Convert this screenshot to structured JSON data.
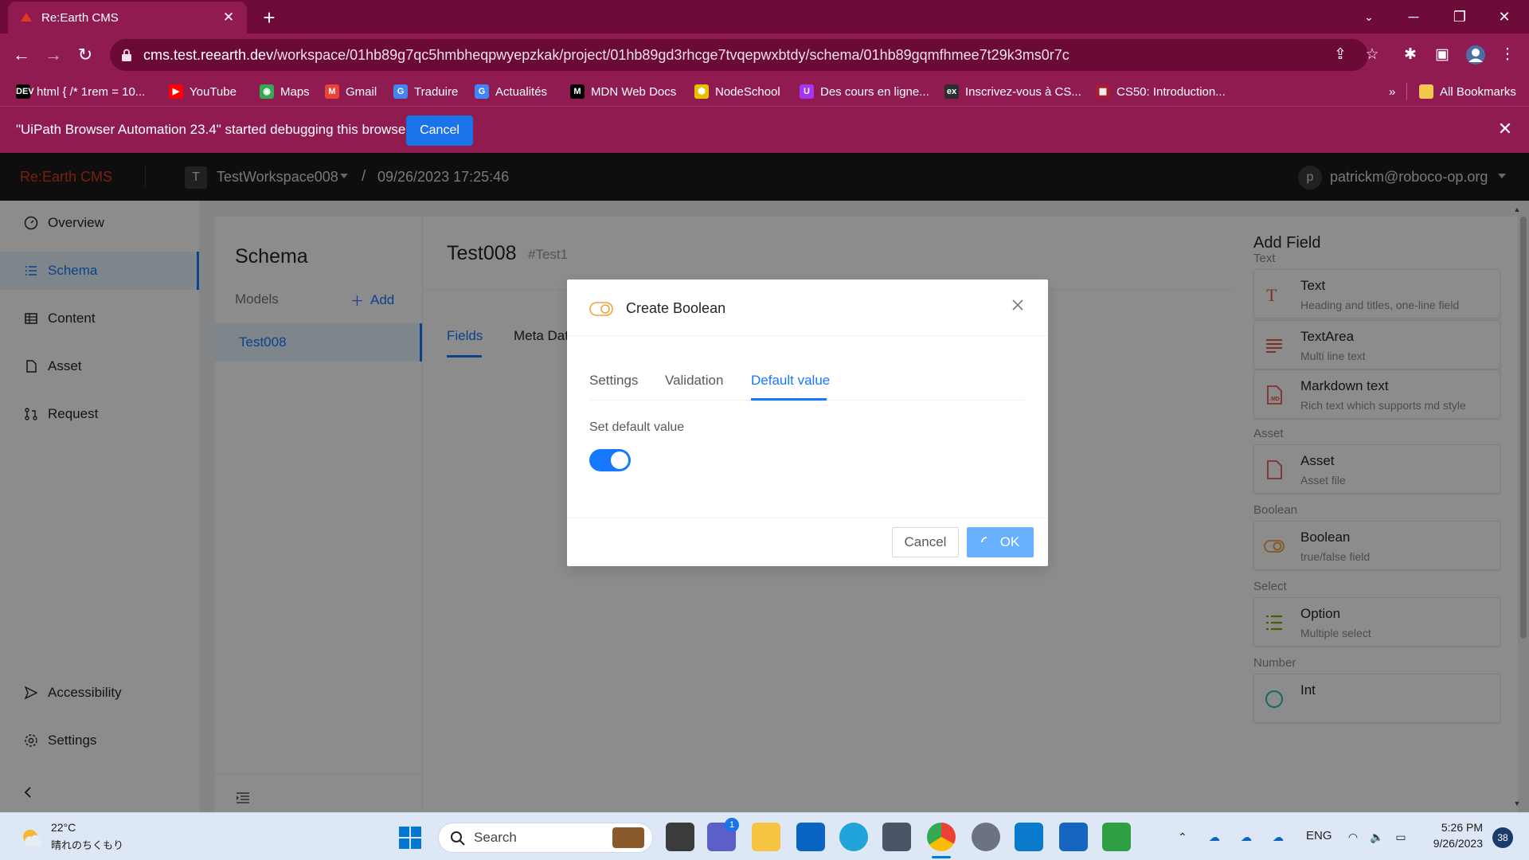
{
  "browser": {
    "tab_title": "Re:Earth CMS",
    "url_host": "cms.test.reearth.dev",
    "url_path": "/workspace/01hb89g7qc5hmbheqpwyepzkak/project/01hb89gd3rhcge7tvqepwxbtdy/schema/01hb89gqmfhmee7t29k3ms0r7c",
    "bookmarks": [
      {
        "label": "html { /* 1rem = 10...",
        "icon": "dev-icon",
        "badge": "DEV",
        "color": "#000000"
      },
      {
        "label": "YouTube",
        "icon": "youtube-icon",
        "badge": "▶",
        "color": "#ff0000"
      },
      {
        "label": "Maps",
        "icon": "maps-icon",
        "badge": "◉",
        "color": "#34a853"
      },
      {
        "label": "Gmail",
        "icon": "gmail-icon",
        "badge": "M",
        "color": "#ea4335"
      },
      {
        "label": "Traduire",
        "icon": "translate-icon",
        "badge": "G",
        "color": "#4285f4"
      },
      {
        "label": "Actualités",
        "icon": "news-icon",
        "badge": "G",
        "color": "#4285f4"
      },
      {
        "label": "MDN Web Docs",
        "icon": "mdn-icon",
        "badge": "M",
        "color": "#000000"
      },
      {
        "label": "NodeSchool",
        "icon": "nodeschool-icon",
        "badge": "⬢",
        "color": "#e8c000"
      },
      {
        "label": "Des cours en ligne...",
        "icon": "udemy-icon",
        "badge": "U",
        "color": "#a435f0"
      },
      {
        "label": "Inscrivez-vous à CS...",
        "icon": "edx-icon",
        "badge": "ex",
        "color": "#2d2d2d"
      },
      {
        "label": "CS50: Introduction...",
        "icon": "cs50-icon",
        "badge": "▦",
        "color": "#a51c30"
      }
    ],
    "bookmarks_overflow": "»",
    "all_bookmarks": "All Bookmarks",
    "debug_message": "\"UiPath Browser Automation 23.4\" started debugging this browser",
    "debug_cancel": "Cancel"
  },
  "app": {
    "logo": "Re:Earth CMS",
    "workspace_initial": "T",
    "workspace_name": "TestWorkspace008",
    "breadcrumb_sep": "/",
    "project_name": "09/26/2023 17:25:46",
    "user_initial": "p",
    "user_email": "patrickm@roboco-op.org"
  },
  "sidebar": {
    "items": [
      {
        "label": "Overview",
        "icon": "dashboard-icon"
      },
      {
        "label": "Schema",
        "icon": "list-icon",
        "active": true
      },
      {
        "label": "Content",
        "icon": "table-icon"
      },
      {
        "label": "Asset",
        "icon": "file-icon"
      },
      {
        "label": "Request",
        "icon": "pull-request-icon"
      }
    ],
    "bottom_items": [
      {
        "label": "Accessibility",
        "icon": "send-icon"
      },
      {
        "label": "Settings",
        "icon": "gear-icon"
      }
    ]
  },
  "schema_panel": {
    "title": "Schema",
    "models_label": "Models",
    "add_label": "Add",
    "models": [
      "Test008"
    ]
  },
  "main": {
    "model_title": "Test008",
    "model_key": "#Test1",
    "tabs": [
      "Fields",
      "Meta Data"
    ]
  },
  "add_field": {
    "title": "Add Field",
    "groups": [
      {
        "label": "Text",
        "items": [
          {
            "name": "Text",
            "desc": "Heading and titles, one-line field",
            "icon": "text-icon",
            "color": "#e5594f"
          },
          {
            "name": "TextArea",
            "desc": "Multi line text",
            "icon": "textarea-icon",
            "color": "#e5594f"
          },
          {
            "name": "Markdown text",
            "desc": "Rich text which supports md style",
            "icon": "markdown-icon",
            "color": "#e5594f"
          }
        ]
      },
      {
        "label": "Asset",
        "items": [
          {
            "name": "Asset",
            "desc": "Asset file",
            "icon": "asset-file-icon",
            "color": "#e5594f"
          }
        ]
      },
      {
        "label": "Boolean",
        "items": [
          {
            "name": "Boolean",
            "desc": "true/false field",
            "icon": "boolean-toggle-icon",
            "color": "#f0a23b"
          }
        ]
      },
      {
        "label": "Select",
        "items": [
          {
            "name": "Option",
            "desc": "Multiple select",
            "icon": "option-list-icon",
            "color": "#7cb305"
          }
        ]
      },
      {
        "label": "Number",
        "items": [
          {
            "name": "Int",
            "desc": "",
            "icon": "int-icon",
            "color": "#13c2c2"
          }
        ]
      }
    ]
  },
  "modal": {
    "title": "Create Boolean",
    "tabs": [
      "Settings",
      "Validation",
      "Default value"
    ],
    "active_tab": "Default value",
    "default_label": "Set default value",
    "default_value": true,
    "cancel": "Cancel",
    "ok": "OK"
  },
  "taskbar": {
    "weather_temp": "22°C",
    "weather_desc": "晴れのちくもり",
    "search_placeholder": "Search",
    "language": "ENG",
    "time": "5:26 PM",
    "date": "9/26/2023",
    "notification_count": "38",
    "chat_badge": "1"
  }
}
